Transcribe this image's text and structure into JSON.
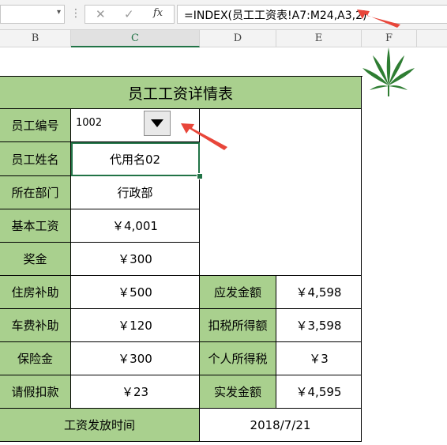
{
  "formula_bar": {
    "name_box": "",
    "cancel_icon": "✕",
    "enter_icon": "✓",
    "fx_icon": "fx",
    "formula": "=INDEX(员工工资表!A7:M24,A3,2)"
  },
  "columns": [
    "B",
    "C",
    "D",
    "E",
    "F"
  ],
  "sheet": {
    "title": "员工工资详情表",
    "rows": [
      {
        "label": "员工编号",
        "value": "1002"
      },
      {
        "label": "员工姓名",
        "value": "代用名02"
      },
      {
        "label": "所在部门",
        "value": "行政部"
      },
      {
        "label": "基本工资",
        "value": "￥4,001"
      },
      {
        "label": "奖金",
        "value": "￥300"
      },
      {
        "label": "住房补助",
        "value": "￥500",
        "label2": "应发金额",
        "value2": "￥4,598"
      },
      {
        "label": "车费补助",
        "value": "￥120",
        "label2": "扣税所得额",
        "value2": "￥3,598"
      },
      {
        "label": "保险金",
        "value": "￥300",
        "label2": "个人所得税",
        "value2": "￥3"
      },
      {
        "label": "请假扣款",
        "value": "￥23",
        "label2": "实发金额",
        "value2": "￥4,595"
      }
    ],
    "footer": {
      "label": "工资发放时间",
      "value": "2018/7/21"
    }
  },
  "colors": {
    "header_green": "#a9d08e",
    "arrow_red": "#e8463a",
    "leaf_green": "#2e7d32",
    "selection_green": "#217346"
  },
  "icons": {
    "dropdown": "triangle-down-icon",
    "decoration": "cannabis-leaf-icon",
    "annotation": "red-arrow-icon"
  }
}
